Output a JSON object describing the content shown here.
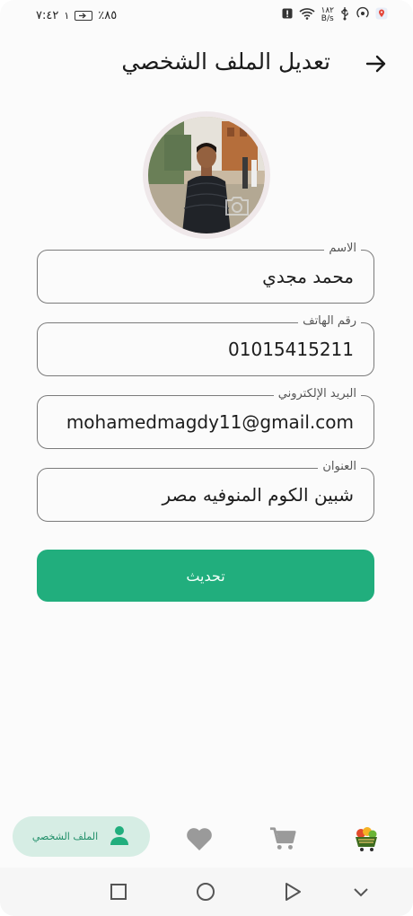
{
  "status_bar": {
    "time": "٧:٤٢",
    "battery_text": "٪٨٥",
    "data_speed_value": "١٨٢",
    "data_speed_unit": "B/s"
  },
  "header": {
    "title": "تعديل الملف الشخصي",
    "back_icon": "arrow-right-icon"
  },
  "profile": {
    "avatar_icon": "profile-photo",
    "camera_icon": "camera-icon"
  },
  "form": {
    "name": {
      "label": "الاسم",
      "value": "محمد مجدي"
    },
    "phone": {
      "label": "رقم الهاتف",
      "value": "01015415211"
    },
    "email": {
      "label": "البريد الإلكتروني",
      "value": "mohamedmagdy11@gmail.com"
    },
    "address": {
      "label": "العنوان",
      "value": "شبين الكوم المنوفيه مصر"
    },
    "submit_label": "تحديث"
  },
  "bottom_nav": {
    "profile_label": "الملف الشخصي",
    "items": [
      "person-icon",
      "heart-icon",
      "cart-icon",
      "home-logo-icon"
    ]
  },
  "colors": {
    "accent": "#21ae7d",
    "accent_light": "#d6ede4",
    "nav_icon": "#9a9a9a"
  }
}
